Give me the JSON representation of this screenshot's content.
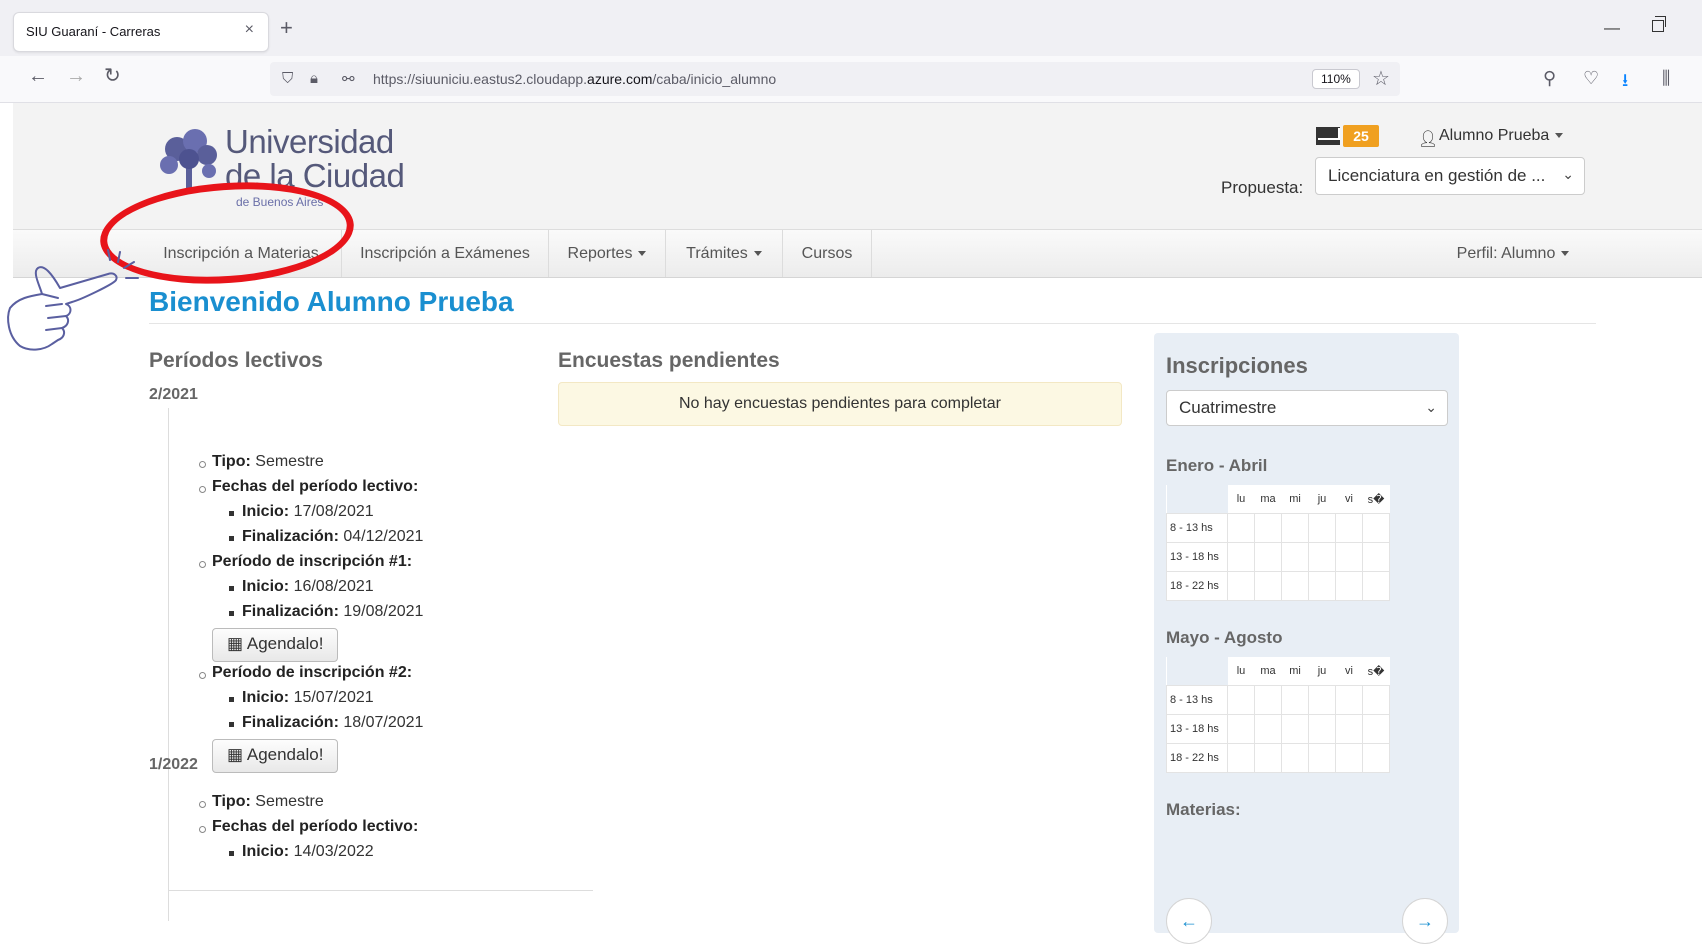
{
  "browser": {
    "tab_title": "SIU Guaraní - Carreras",
    "tab_close": "×",
    "new_tab": "+",
    "url_prefix": "https://siuuniciu.eastus2.cloudapp.",
    "url_domain": "azure.com",
    "url_path": "/caba/inicio_alumno",
    "zoom": "110%",
    "minimize": "—"
  },
  "logo": {
    "line1": "Universidad",
    "line2": "de la Ciudad",
    "line3": "de Buenos Aires"
  },
  "header": {
    "messages_count": "25",
    "user_menu": "Alumno Prueba",
    "propuesta_label": "Propuesta:",
    "propuesta_value": "Licenciatura en gestión de ..."
  },
  "menu": {
    "items": [
      "Inscripción a Materias",
      "Inscripción a Exámenes",
      "Reportes",
      "Trámites",
      "Cursos"
    ],
    "profile": "Perfil: Alumno"
  },
  "welcome": "Bienvenido Alumno Prueba",
  "periodos": {
    "heading": "Períodos lectivos",
    "p1": {
      "name": "2/2021",
      "tipo_label": "Tipo:",
      "tipo_value": "Semestre",
      "fechas_label": "Fechas del período lectivo:",
      "inicio_label": "Inicio:",
      "inicio": "17/08/2021",
      "fin_label": "Finalización:",
      "fin": "04/12/2021",
      "insc1_label": "Período de inscripción #1:",
      "insc1_inicio": "16/08/2021",
      "insc1_fin": "19/08/2021",
      "insc2_label": "Período de inscripción #2:",
      "insc2_inicio": "15/07/2021",
      "insc2_fin": "18/07/2021",
      "agendalo": "Agendalo!"
    },
    "p2": {
      "name": "1/2022",
      "tipo_label": "Tipo:",
      "tipo_value": "Semestre",
      "fechas_label": "Fechas del período lectivo:",
      "inicio_label": "Inicio:",
      "inicio": "14/03/2022"
    }
  },
  "encuestas": {
    "heading": "Encuestas pendientes",
    "message": "No hay encuestas pendientes para completar"
  },
  "inscripciones": {
    "heading": "Inscripciones",
    "select_value": "Cuatrimestre",
    "block1": "Enero - Abril",
    "block2": "Mayo - Agosto",
    "days": [
      "lu",
      "ma",
      "mi",
      "ju",
      "vi",
      "s�"
    ],
    "rows": [
      "8 - 13 hs",
      "13 - 18 hs",
      "18 - 22 hs"
    ],
    "materias": "Materias:",
    "prev": "←",
    "next": "→"
  }
}
